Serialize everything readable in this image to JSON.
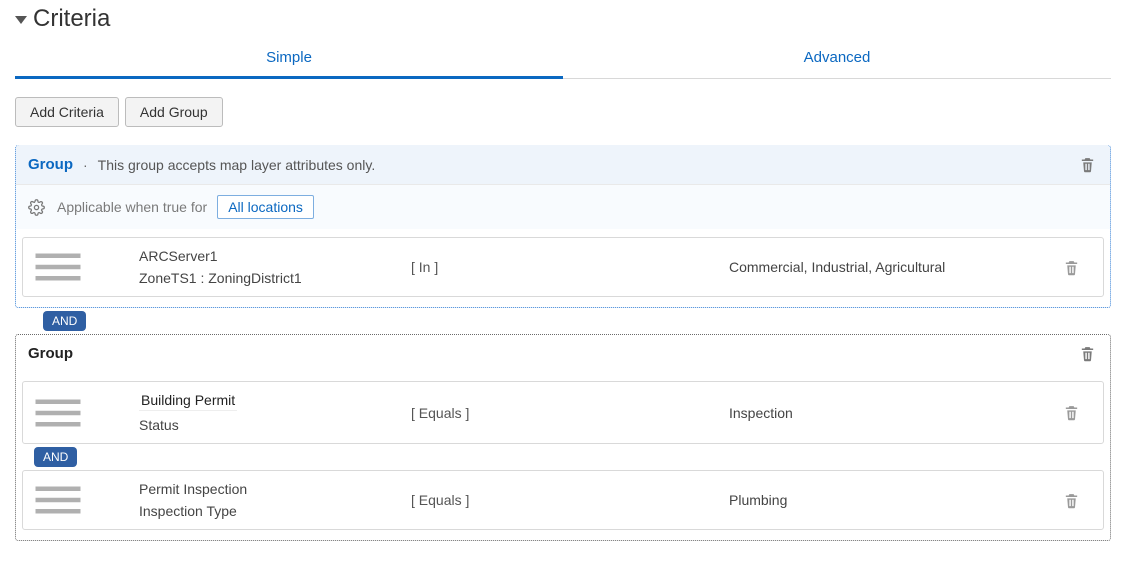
{
  "title": "Criteria",
  "tabs": {
    "simple": "Simple",
    "advanced": "Advanced"
  },
  "buttons": {
    "add_criteria": "Add Criteria",
    "add_group": "Add Group"
  },
  "group1": {
    "label": "Group",
    "sep": "·",
    "desc": "This group accepts map layer attributes only.",
    "applicable_text": "Applicable when true for",
    "applicable_value": "All locations",
    "rule1": {
      "field_top": "ARCServer1",
      "field_sub": "ZoneTS1 : ZoningDistrict1",
      "op": "[ In ]",
      "value": "Commercial, Industrial, Agricultural"
    }
  },
  "connector1": "AND",
  "group2": {
    "label": "Group",
    "rule1": {
      "field_top": "Building Permit",
      "field_sub": "Status",
      "op": "[ Equals ]",
      "value": "Inspection"
    },
    "connector": "AND",
    "rule2": {
      "field_top": "Permit Inspection",
      "field_sub": "Inspection Type",
      "op": "[ Equals ]",
      "value": "Plumbing"
    }
  }
}
